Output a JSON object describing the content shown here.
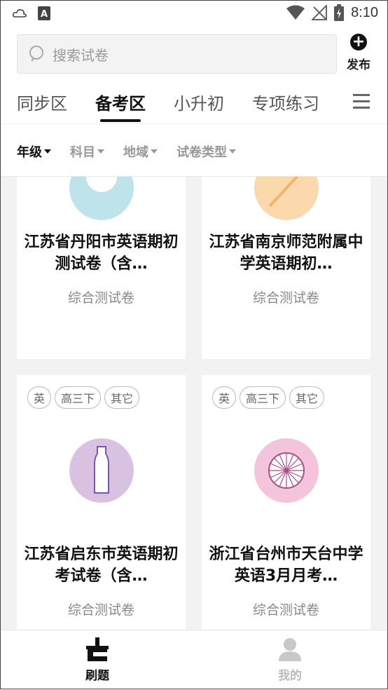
{
  "status_bar": {
    "time": "8:10",
    "icons": [
      "cloud-icon",
      "a-notification-icon",
      "wifi-icon",
      "no-signal-icon",
      "battery-charging-icon"
    ]
  },
  "search": {
    "placeholder": "搜索试卷",
    "icon": "search-icon"
  },
  "publish": {
    "label": "发布",
    "icon": "plus-circle-icon"
  },
  "tabs": [
    {
      "label": "同步区",
      "active": false
    },
    {
      "label": "备考区",
      "active": true
    },
    {
      "label": "小升初",
      "active": false
    },
    {
      "label": "专项练习",
      "active": false
    }
  ],
  "filters": [
    {
      "label": "年级",
      "active": true
    },
    {
      "label": "科目",
      "active": false
    },
    {
      "label": "地域",
      "active": false
    },
    {
      "label": "试卷类型",
      "active": false
    }
  ],
  "cards": [
    {
      "title": "江苏省丹阳市英语期初测试卷（含…",
      "type": "综合测试卷",
      "tags": [],
      "icon": "tape-roll-icon",
      "icon_color": "#bfe3ea"
    },
    {
      "title": "江苏省南京师范附属中学英语期初…",
      "type": "综合测试卷",
      "tags": [],
      "icon": "pencil-icon",
      "icon_color": "#fcd9ad"
    },
    {
      "title": "江苏省启东市英语期初考试卷（含…",
      "type": "综合测试卷",
      "tags": [
        "英",
        "高三下",
        "其它"
      ],
      "icon": "bottle-icon",
      "icon_color": "#d9c1e1"
    },
    {
      "title": "浙江省台州市天台中学英语3月月考…",
      "type": "综合测试卷",
      "tags": [
        "英",
        "高三下",
        "其它"
      ],
      "icon": "citrus-slice-icon",
      "icon_color": "#f4c4dc"
    }
  ],
  "bottom_nav": [
    {
      "label": "刷题",
      "active": true,
      "icon": "brush-icon"
    },
    {
      "label": "我的",
      "active": false,
      "icon": "person-icon"
    }
  ],
  "colors": {
    "active_text": "#111111",
    "inactive_text": "#999999",
    "background": "#f2f2f2"
  }
}
